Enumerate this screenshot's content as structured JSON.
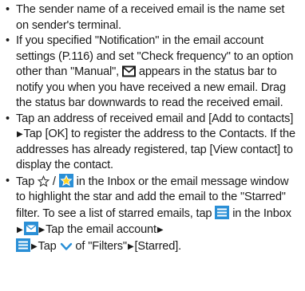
{
  "notes": [
    {
      "text": "The sender name of a received email is the name set on sender's terminal."
    },
    {
      "text_a": "If you specified \"Notification\" in the email account settings (P.116) and set \"Check frequency\" to an option other than \"Manual\", ",
      "icon": "mail-envelope-icon",
      "text_b": " appears in the status bar to notify you when you have received a new email. Drag the status bar downwards to read the received email."
    },
    {
      "text_a": "Tap an address of received email and [Add to contacts]",
      "arrow": "▶",
      "text_b": "Tap [OK] to register the address to the Contacts. If the addresses has already registered, tap [View contact] to display the contact."
    },
    {
      "t1": "Tap ",
      "icon_star_outline": "star-outline-icon",
      "t2": " / ",
      "icon_star_filled": "star-filled-icon",
      "t3": " in the Inbox or the email message window to highlight the star and add the email to the \"Starred\" filter. To see a list of starred emails, tap ",
      "icon_menu_a": "menu-lines-icon",
      "t4": " in the Inbox",
      "arrow": "▶",
      "icon_mail_blue": "mail-app-icon",
      "t5": "Tap the email account",
      "icon_menu_b": "menu-lines-icon",
      "t6": "Tap ",
      "icon_chevron": "chevron-down-icon",
      "t7": " of \"Filters\"",
      "t8": "[Starred]."
    }
  ],
  "bullet_glyph": "•",
  "colors": {
    "icon_blue": "#2a8fd6",
    "text": "#1a1a1a"
  }
}
